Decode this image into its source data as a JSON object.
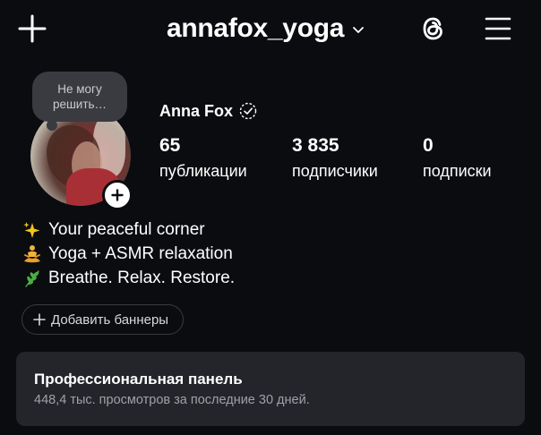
{
  "header": {
    "username": "annafox_yoga",
    "new_post_icon": "plus-icon",
    "switch_account_icon": "chevron-down-icon",
    "threads_icon": "threads-icon",
    "menu_icon": "hamburger-menu-icon"
  },
  "profile": {
    "note": "Не могу решить…",
    "display_name": "Anna Fox",
    "verified_icon": "dashed-check-badge-icon",
    "add_story_icon": "plus-icon",
    "stats": [
      {
        "value": "65",
        "label": "публикации"
      },
      {
        "value": "3 835",
        "label": "подписчики"
      },
      {
        "value": "0",
        "label": "подписки"
      }
    ]
  },
  "bio": [
    {
      "icon": "sparkles-icon",
      "text": "Your peaceful corner"
    },
    {
      "icon": "person-lotus-icon",
      "text": "Yoga + ASMR relaxation"
    },
    {
      "icon": "herb-icon",
      "text": "Breathe. Relax. Restore."
    }
  ],
  "banners": {
    "label": "Добавить баннеры",
    "icon": "plus-icon"
  },
  "professional_panel": {
    "title": "Профессиональная панель",
    "subtitle": "448,4 тыс. просмотров за последние 30 дней."
  },
  "colors": {
    "background": "#0b0c10",
    "panel": "#24252b",
    "note_bubble": "#3a3b40",
    "text_primary": "#ffffff",
    "text_secondary": "#a0a0a8"
  }
}
